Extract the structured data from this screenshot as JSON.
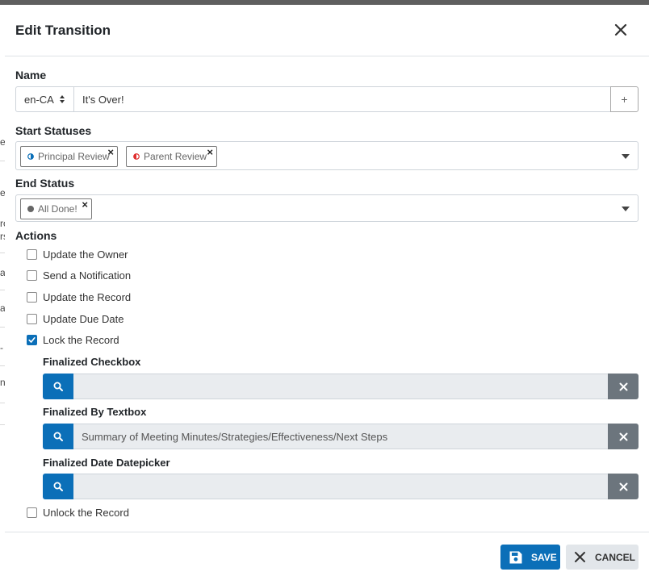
{
  "dialog": {
    "title": "Edit Transition"
  },
  "background": {
    "fragments": [
      "es",
      "e",
      "ro",
      "rs",
      "ar",
      "a",
      "-",
      "n"
    ]
  },
  "name": {
    "label": "Name",
    "language": "en-CA",
    "value": "It's Over!",
    "add_label": "+"
  },
  "start_statuses": {
    "label": "Start Statuses",
    "items": [
      {
        "label": "Principal Review",
        "icon": "half-circle-blue",
        "color": "#0b6fb8"
      },
      {
        "label": "Parent Review",
        "icon": "half-circle-red",
        "color": "#e02f2f"
      }
    ]
  },
  "end_status": {
    "label": "End Status",
    "items": [
      {
        "label": "All Done!",
        "icon": "circle-gray",
        "color": "#666666"
      }
    ]
  },
  "actions": {
    "label": "Actions",
    "items": [
      {
        "label": "Update the Owner",
        "checked": false
      },
      {
        "label": "Send a Notification",
        "checked": false
      },
      {
        "label": "Update the Record",
        "checked": false
      },
      {
        "label": "Update Due Date",
        "checked": false
      },
      {
        "label": "Lock the Record",
        "checked": true
      },
      {
        "label": "Unlock the Record",
        "checked": false
      }
    ],
    "lock_fields": [
      {
        "label": "Finalized Checkbox",
        "value": ""
      },
      {
        "label": "Finalized By Textbox",
        "value": "Summary of Meeting Minutes/Strategies/Effectiveness/Next Steps"
      },
      {
        "label": "Finalized Date Datepicker",
        "value": ""
      }
    ]
  },
  "footer": {
    "save_label": "SAVE",
    "cancel_label": "CANCEL"
  },
  "colors": {
    "primary": "#0b6fb8",
    "secondary": "#6c757d"
  }
}
